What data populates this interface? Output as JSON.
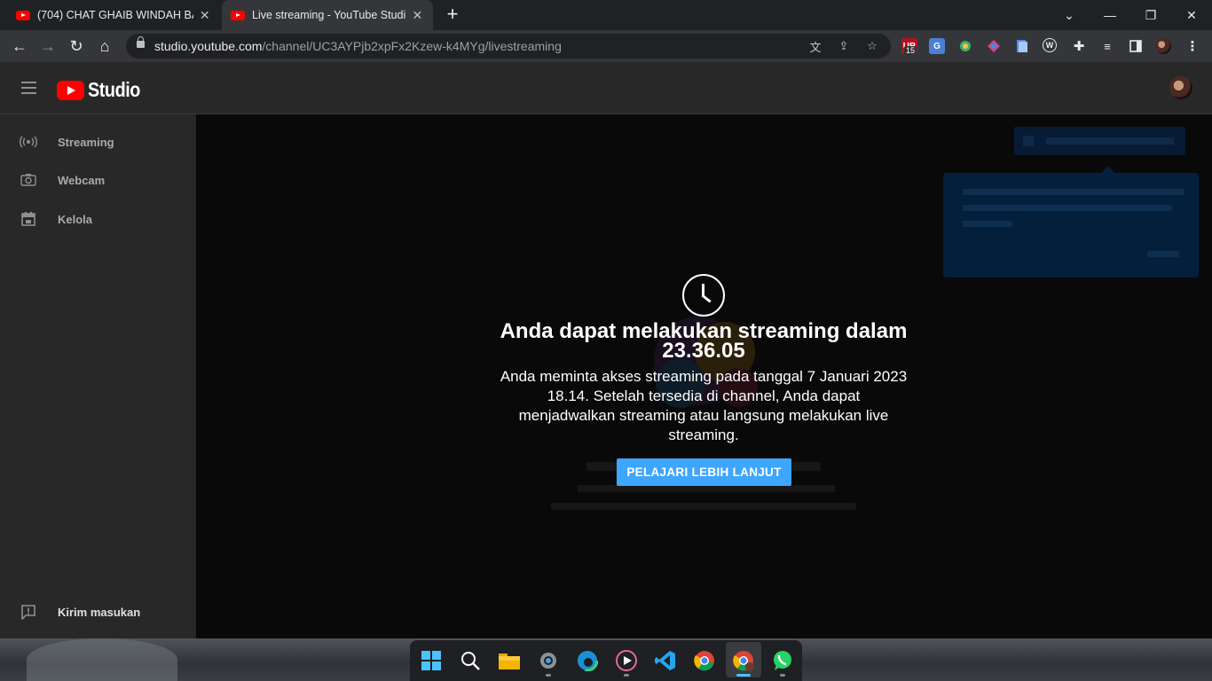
{
  "browser": {
    "tabs": [
      {
        "title": "(704) CHAT GHAIB WINDAH BASI",
        "active": false
      },
      {
        "title": "Live streaming - YouTube Studio",
        "active": true
      }
    ],
    "url_host": "studio.youtube.com",
    "url_path": "/channel/UC3AYPjb2xpFx2Kzew-k4MYg/livestreaming",
    "extension_badge": "15"
  },
  "studio": {
    "logo_text": "Studio",
    "sidebar": [
      {
        "label": "Streaming"
      },
      {
        "label": "Webcam"
      },
      {
        "label": "Kelola"
      }
    ],
    "feedback_label": "Kirim masukan"
  },
  "notice": {
    "headline": "Anda dapat melakukan streaming dalam",
    "countdown": "23.36.05",
    "description": "Anda meminta akses streaming pada tanggal 7 Januari 2023 18.14. Setelah tersedia di channel, Anda dapat menjadwalkan streaming atau langsung melakukan live streaming.",
    "cta_label": "PELAJARI LEBIH LANJUT"
  },
  "colors": {
    "accent": "#3ea6ff",
    "brand_red": "#ff0000"
  }
}
